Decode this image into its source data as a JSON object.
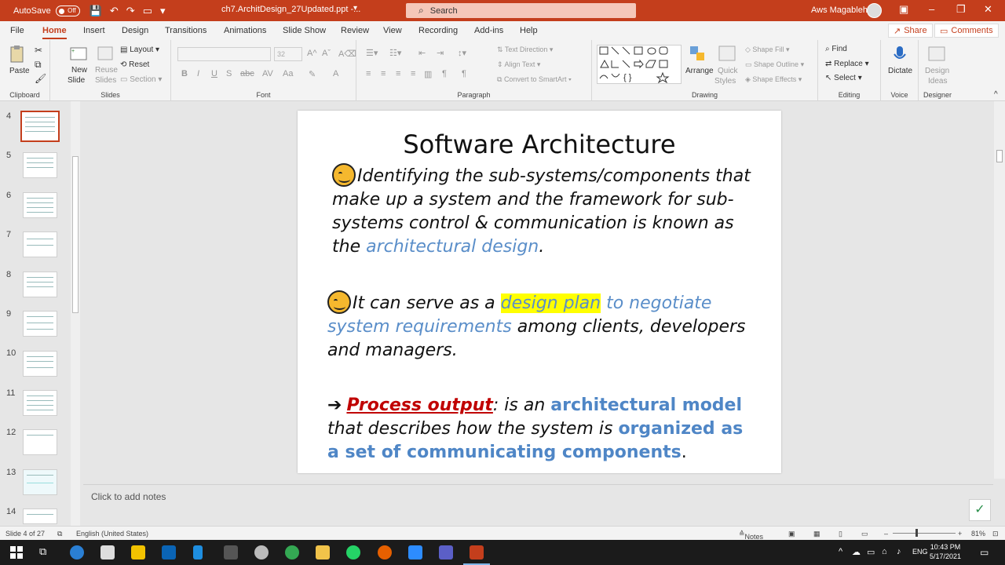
{
  "titlebar": {
    "autosave_label": "AutoSave",
    "autosave_state": "Off",
    "filename": "ch7.ArchitDesign_27Updated.ppt  -...",
    "search_placeholder": "Search",
    "user_name": "Aws Magableh"
  },
  "tabs": [
    "File",
    "Home",
    "Insert",
    "Design",
    "Transitions",
    "Animations",
    "Slide Show",
    "Review",
    "View",
    "Recording",
    "Add-ins",
    "Help"
  ],
  "active_tab": "Home",
  "share_label": "Share",
  "comments_label": "Comments",
  "ribbon": {
    "clipboard": {
      "label": "Clipboard",
      "paste": "Paste"
    },
    "slides": {
      "label": "Slides",
      "new_slide": "New",
      "new_slide2": "Slide",
      "reuse": "Reuse",
      "reuse2": "Slides",
      "layout": "Layout",
      "reset": "Reset",
      "section": "Section"
    },
    "font": {
      "label": "Font",
      "size": "32"
    },
    "paragraph": {
      "label": "Paragraph",
      "text_direction": "Text Direction",
      "align_text": "Align Text",
      "smartart": "Convert to SmartArt"
    },
    "drawing": {
      "label": "Drawing",
      "arrange": "Arrange",
      "quick_styles": "Quick",
      "quick_styles2": "Styles",
      "shape_fill": "Shape Fill",
      "shape_outline": "Shape Outline",
      "shape_effects": "Shape Effects"
    },
    "editing": {
      "label": "Editing",
      "find": "Find",
      "replace": "Replace",
      "select": "Select"
    },
    "voice": {
      "label": "Voice",
      "dictate": "Dictate"
    },
    "designer": {
      "label": "Designer",
      "design_ideas": "Design",
      "design_ideas2": "Ideas"
    }
  },
  "thumbnails": [
    "4",
    "5",
    "6",
    "7",
    "8",
    "9",
    "10",
    "11",
    "12",
    "13",
    "14"
  ],
  "slide": {
    "title": "Software Architecture",
    "p1": {
      "text": "Identifying the sub-systems/components that make up a system and the framework for sub-systems control & communication is known as the ",
      "blue": "architectural design",
      "end": "."
    },
    "p2": {
      "lead": "It can serve as a ",
      "highlight": "design plan",
      "blue": " to negotiate system requirements",
      "end": " among clients, developers and managers."
    },
    "p3": {
      "red": "Process output",
      "mid": ":  is an ",
      "b1": "architectural model",
      "mid2": " that describes how the system is ",
      "b2": "organized as a set of communicating components",
      "end": "."
    }
  },
  "notes_placeholder": "Click to add notes",
  "status": {
    "slide_info": "Slide 4 of 27",
    "language": "English (United States)",
    "notes": "Notes",
    "zoom": "81%"
  },
  "taskbar": {
    "lang": "ENG",
    "time": "10:43 PM",
    "date": "5/17/2021"
  },
  "colors": {
    "accent": "#c43e1c",
    "slide_blue": "#5a8ec9",
    "highlight": "#ffff00",
    "red_text": "#c00000"
  }
}
